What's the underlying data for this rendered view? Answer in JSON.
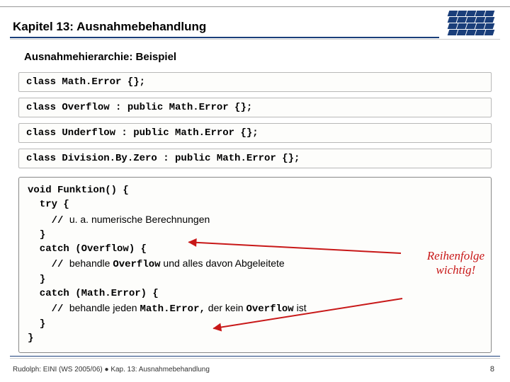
{
  "chapter": "Kapitel 13: Ausnahmebehandlung",
  "subtitle": "Ausnahmehierarchie: Beispiel",
  "code_bars": [
    "class Math.Error {};",
    "class Overflow : public Math.Error {};",
    "class Underflow : public Math.Error {};",
    "class Division.By.Zero : public Math.Error {};"
  ],
  "block": {
    "l1": "void Funktion() {",
    "l2": "  try {",
    "l3a": "    // ",
    "l3b": "u. a. numerische Berechnungen",
    "l4": "  }",
    "l5": "  catch (Overflow) {",
    "l6a": "    // ",
    "l6b": "behandle ",
    "l6c": "Overflow",
    "l6d": " und alles davon Abgeleitete",
    "l7": "  }",
    "l8": "  catch (Math.Error) {",
    "l9a": "    // ",
    "l9b": "behandle jeden ",
    "l9c": "Math.Error,",
    "l9d": " der kein ",
    "l9e": "Overflow",
    "l9f": " ist",
    "l10": "  }",
    "l11": "}"
  },
  "callout": {
    "line1": "Reihenfolge",
    "line2": "wichtig!"
  },
  "footer": "Rudolph: EINI (WS 2005/06) ● Kap. 13: Ausnahmebehandlung",
  "page": "8"
}
